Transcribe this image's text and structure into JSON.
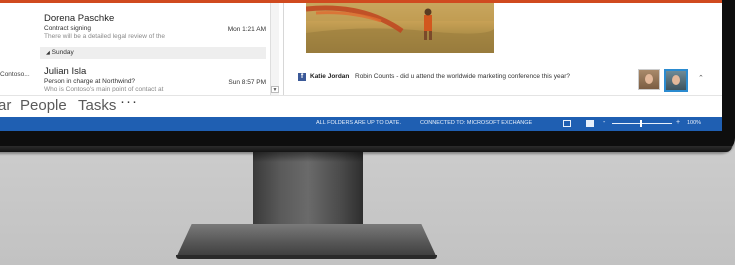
{
  "mail_list": {
    "items": [
      {
        "sender": "Dorena Paschke",
        "subject": "Contract signing",
        "preview": "There will be a detailed legal review of the",
        "time": "Mon 1:21 AM"
      },
      {
        "sender": "Julian Isla",
        "subject": "Person in charge at Northwind?",
        "preview": "Who is Contoso's main point of contact at",
        "time": "Sun 8:57 PM"
      }
    ],
    "group_header": "Sunday",
    "folder_label": "Contoso..."
  },
  "reading_pane": {
    "social": {
      "name": "Katie Jordan",
      "text": "Robin Counts - did u attend the worldwide marketing conference this year?"
    }
  },
  "nav": {
    "items": [
      "ar",
      "People",
      "Tasks"
    ],
    "more": "···"
  },
  "status": {
    "sync": "ALL FOLDERS ARE UP TO DATE.",
    "connection": "CONNECTED TO: MICROSOFT EXCHANGE",
    "zoom_minus": "-",
    "zoom_plus": "+",
    "zoom": "100%"
  },
  "colors": {
    "accent_orange": "#d04a1f",
    "status_blue": "#1f5fb2",
    "facebook_blue": "#3b5998"
  },
  "icons": {
    "facebook": "facebook-icon",
    "reading_view": "reading-view-icon",
    "normal_view": "normal-view-icon"
  }
}
